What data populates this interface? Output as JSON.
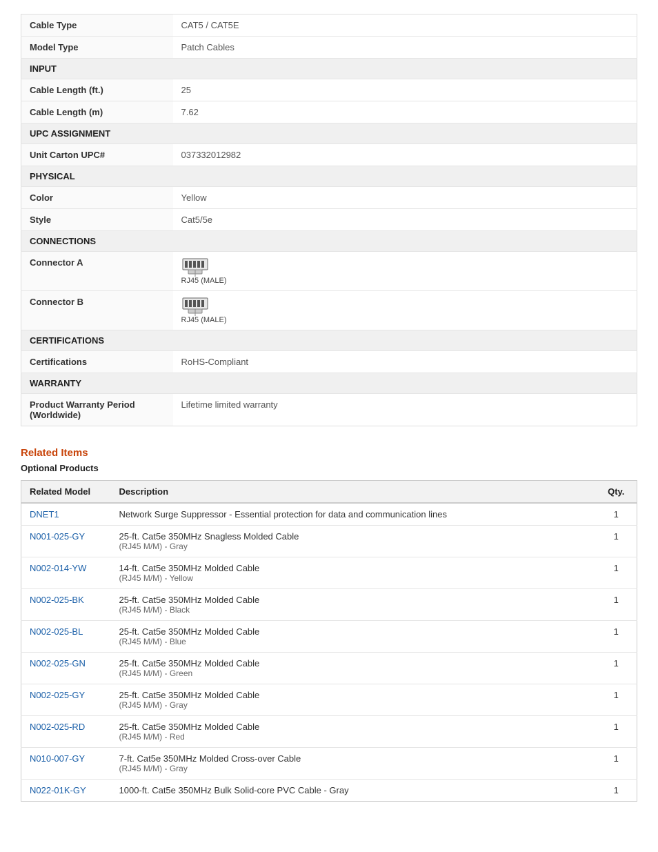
{
  "specs": {
    "rows": [
      {
        "type": "row",
        "label": "Cable Type",
        "value": "CAT5 / CAT5E"
      },
      {
        "type": "row",
        "label": "Model Type",
        "value": "Patch Cables"
      },
      {
        "type": "section",
        "label": "INPUT"
      },
      {
        "type": "row",
        "label": "Cable Length (ft.)",
        "value": "25"
      },
      {
        "type": "row",
        "label": "Cable Length (m)",
        "value": "7.62"
      },
      {
        "type": "section",
        "label": "UPC ASSIGNMENT"
      },
      {
        "type": "row",
        "label": "Unit Carton UPC#",
        "value": "037332012982"
      },
      {
        "type": "section",
        "label": "PHYSICAL"
      },
      {
        "type": "row",
        "label": "Color",
        "value": "Yellow"
      },
      {
        "type": "row",
        "label": "Style",
        "value": "Cat5/5e"
      },
      {
        "type": "section",
        "label": "CONNECTIONS"
      },
      {
        "type": "connector",
        "label": "Connector A",
        "value": "RJ45 (MALE)"
      },
      {
        "type": "connector",
        "label": "Connector B",
        "value": "RJ45 (MALE)"
      },
      {
        "type": "section",
        "label": "CERTIFICATIONS"
      },
      {
        "type": "row",
        "label": "Certifications",
        "value": "RoHS-Compliant"
      },
      {
        "type": "section",
        "label": "WARRANTY"
      },
      {
        "type": "row",
        "label": "Product Warranty Period (Worldwide)",
        "value": "Lifetime limited warranty"
      }
    ]
  },
  "related": {
    "title": "Related Items",
    "optional_label": "Optional Products",
    "columns": {
      "model": "Related Model",
      "description": "Description",
      "qty": "Qty."
    },
    "items": [
      {
        "model": "DNET1",
        "description": "Network Surge Suppressor - Essential protection for data and communication lines",
        "description_sub": "",
        "qty": "1"
      },
      {
        "model": "N001-025-GY",
        "description": "25-ft. Cat5e 350MHz Snagless Molded Cable",
        "description_sub": "(RJ45 M/M) - Gray",
        "qty": "1"
      },
      {
        "model": "N002-014-YW",
        "description": "14-ft. Cat5e 350MHz Molded Cable",
        "description_sub": "(RJ45 M/M) - Yellow",
        "qty": "1"
      },
      {
        "model": "N002-025-BK",
        "description": "25-ft. Cat5e 350MHz Molded Cable",
        "description_sub": "(RJ45 M/M) - Black",
        "qty": "1"
      },
      {
        "model": "N002-025-BL",
        "description": "25-ft. Cat5e 350MHz Molded Cable",
        "description_sub": "(RJ45 M/M) - Blue",
        "qty": "1"
      },
      {
        "model": "N002-025-GN",
        "description": "25-ft. Cat5e 350MHz Molded Cable",
        "description_sub": "(RJ45 M/M) - Green",
        "qty": "1"
      },
      {
        "model": "N002-025-GY",
        "description": "25-ft. Cat5e 350MHz Molded Cable",
        "description_sub": "(RJ45 M/M) - Gray",
        "qty": "1"
      },
      {
        "model": "N002-025-RD",
        "description": "25-ft. Cat5e 350MHz Molded Cable",
        "description_sub": "(RJ45 M/M) - Red",
        "qty": "1"
      },
      {
        "model": "N010-007-GY",
        "description": "7-ft. Cat5e 350MHz Molded Cross-over Cable",
        "description_sub": "(RJ45 M/M) - Gray",
        "qty": "1"
      },
      {
        "model": "N022-01K-GY",
        "description": "1000-ft. Cat5e 350MHz Bulk Solid-core PVC Cable - Gray",
        "description_sub": "",
        "qty": "1"
      }
    ]
  }
}
